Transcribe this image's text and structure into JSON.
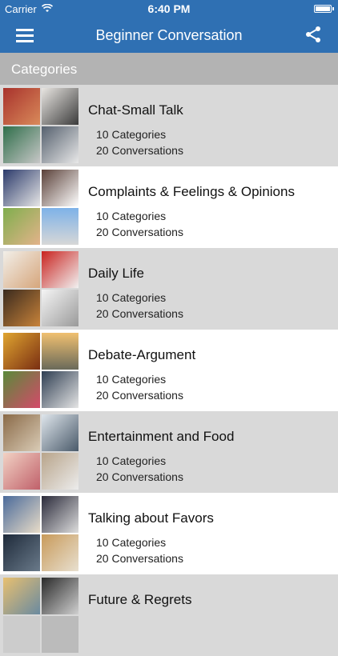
{
  "status": {
    "carrier": "Carrier",
    "time": "6:40 PM"
  },
  "nav": {
    "title": "Beginner Conversation",
    "menu_icon": "hamburger-icon",
    "share_icon": "share-icon"
  },
  "section": {
    "title": "Categories"
  },
  "colors": {
    "accent": "#2f70b3",
    "section_bg": "#b3b3b3",
    "row_alt": "#d9d9d9"
  },
  "rows": [
    {
      "name": "Chat-Small Talk",
      "categories": "10 Categories",
      "conversations": "20 Conversations"
    },
    {
      "name": "Complaints & Feelings & Opinions",
      "categories": "10 Categories",
      "conversations": "20 Conversations"
    },
    {
      "name": "Daily Life",
      "categories": "10 Categories",
      "conversations": "20 Conversations"
    },
    {
      "name": "Debate-Argument",
      "categories": "10 Categories",
      "conversations": "20 Conversations"
    },
    {
      "name": "Entertainment and Food",
      "categories": "10 Categories",
      "conversations": "20 Conversations"
    },
    {
      "name": "Talking about Favors",
      "categories": "10 Categories",
      "conversations": "20 Conversations"
    },
    {
      "name": "Future & Regrets",
      "categories": "",
      "conversations": ""
    }
  ]
}
